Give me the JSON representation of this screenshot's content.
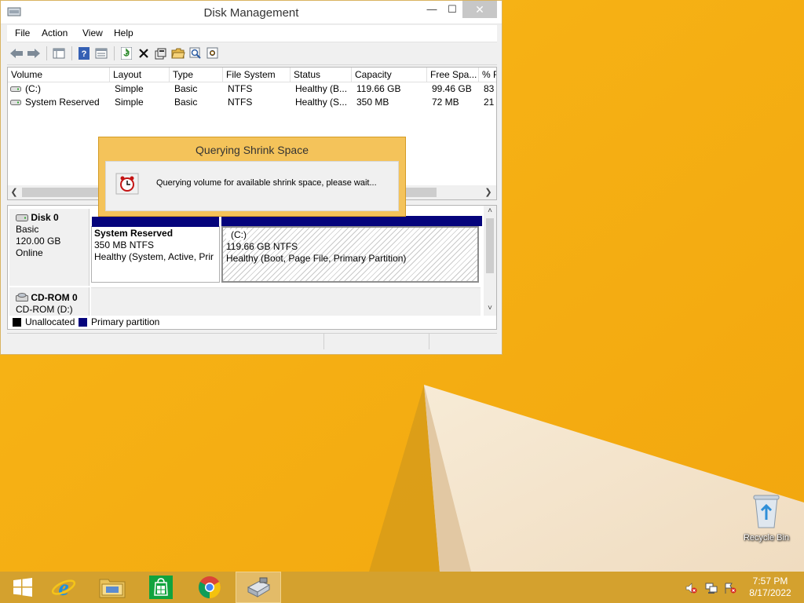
{
  "window": {
    "title": "Disk Management",
    "controls": {
      "minimize": "—",
      "maximize": "☐",
      "close": "✕"
    }
  },
  "menu": [
    "File",
    "Action",
    "View",
    "Help"
  ],
  "toolbar": {
    "icons": [
      "back-arrow-icon",
      "forward-arrow-icon",
      "console-tree-icon",
      "help-icon",
      "properties-icon",
      "refresh-icon",
      "delete-icon",
      "rescan-icon",
      "open-folder-icon",
      "search-icon",
      "settings-icon"
    ]
  },
  "volume_list": {
    "columns": [
      "Volume",
      "Layout",
      "Type",
      "File System",
      "Status",
      "Capacity",
      "Free Spa...",
      "% F"
    ],
    "rows": [
      [
        "(C:)",
        "Simple",
        "Basic",
        "NTFS",
        "Healthy (B...",
        "119.66 GB",
        "99.46 GB",
        "83"
      ],
      [
        "System Reserved",
        "Simple",
        "Basic",
        "NTFS",
        "Healthy (S...",
        "350 MB",
        "72 MB",
        "21"
      ]
    ]
  },
  "disks": [
    {
      "name": "Disk 0",
      "type": "Basic",
      "size": "120.00 GB",
      "state": "Online",
      "partitions": [
        {
          "name": "System Reserved",
          "size": "350 MB NTFS",
          "status": "Healthy (System, Active, Prir"
        },
        {
          "name": "(C:)",
          "size": "119.66 GB NTFS",
          "status": "Healthy (Boot, Page File, Primary Partition)"
        }
      ]
    },
    {
      "name": "CD-ROM 0",
      "type": "CD-ROM (D:)"
    }
  ],
  "legend": {
    "unallocated": "Unallocated",
    "primary": "Primary partition",
    "unallocated_color": "#000000",
    "primary_color": "#05047c"
  },
  "dialog": {
    "title": "Querying Shrink Space",
    "message": "Querying volume for available shrink space, please wait..."
  },
  "desktop": {
    "recycle_bin_label": "Recycle Bin"
  },
  "taskbar": {
    "apps": [
      "start-icon",
      "internet-explorer-icon",
      "file-explorer-icon",
      "store-icon",
      "chrome-icon",
      "disk-management-icon"
    ],
    "time": "7:57 PM",
    "date": "8/17/2022"
  },
  "colors": {
    "wallpaper": "#f5ad12",
    "taskbar": "#d4a12e",
    "dialog_frame": "#f4c35a",
    "partition_bar": "#05047c"
  }
}
